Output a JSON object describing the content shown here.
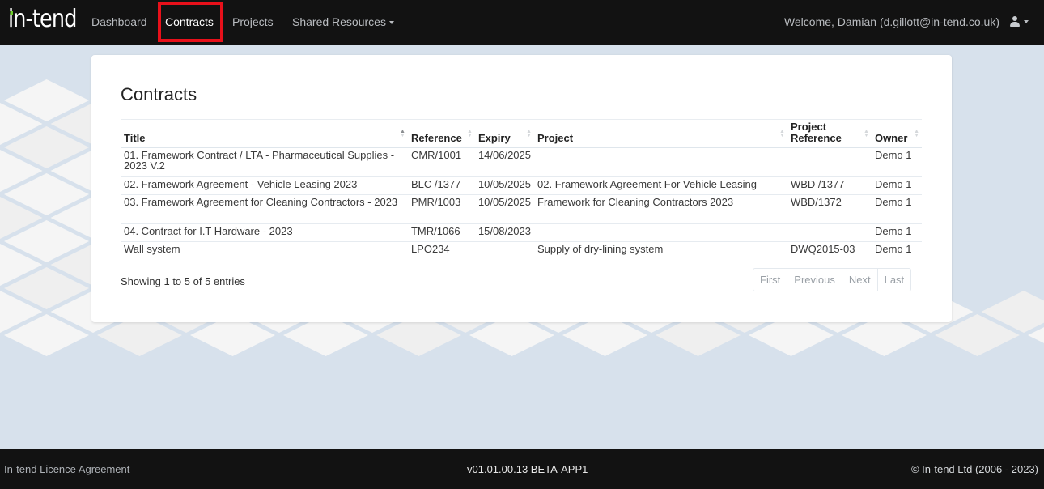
{
  "navbar": {
    "brand": "in-tend",
    "items": [
      {
        "label": "Dashboard",
        "active": false
      },
      {
        "label": "Contracts",
        "active": true
      },
      {
        "label": "Projects",
        "active": false
      },
      {
        "label": "Shared Resources",
        "active": false,
        "has_dropdown": true
      }
    ],
    "welcome": "Welcome, Damian (d.gillott@in-tend.co.uk)",
    "user_icon": "user-icon",
    "highlight_color": "#e8101a"
  },
  "page": {
    "title": "Contracts"
  },
  "table": {
    "columns": [
      "Title",
      "Reference",
      "Expiry",
      "Project",
      "Project Reference",
      "Owner"
    ],
    "sorted_column": "Title",
    "rows": [
      {
        "title": "01. Framework Contract / LTA - Pharmaceutical Supplies - 2023 V.2",
        "reference": "CMR/1001",
        "expiry": "14/06/2025",
        "project": "",
        "project_reference": "",
        "owner": "Demo 1"
      },
      {
        "title": "02. Framework Agreement - Vehicle Leasing 2023",
        "reference": "BLC /1377",
        "expiry": "10/05/2025",
        "project": "02. Framework Agreement For Vehicle Leasing",
        "project_reference": "WBD /1377",
        "owner": "Demo 1"
      },
      {
        "title": "03. Framework Agreement for Cleaning Contractors - 2023",
        "reference": "PMR/1003",
        "expiry": "10/05/2025",
        "project": "Framework for Cleaning Contractors 2023",
        "project_reference": "WBD/1372",
        "owner": "Demo 1"
      },
      {
        "title": "04. Contract for I.T Hardware - 2023",
        "reference": "TMR/1066",
        "expiry": "15/08/2023",
        "project": "",
        "project_reference": "",
        "owner": "Demo 1"
      },
      {
        "title": "Wall system",
        "reference": "LPO234",
        "expiry": "",
        "project": "Supply of dry-lining system",
        "project_reference": "DWQ2015-03",
        "owner": "Demo 1"
      }
    ]
  },
  "table_info": "Showing 1 to 5 of 5 entries",
  "pagination": [
    "First",
    "Previous",
    "Next",
    "Last"
  ],
  "footer": {
    "licence_link": "In-tend Licence Agreement",
    "version": "v01.01.00.13  BETA-APP1",
    "copyright": "© In-tend Ltd (2006 - 2023)"
  }
}
